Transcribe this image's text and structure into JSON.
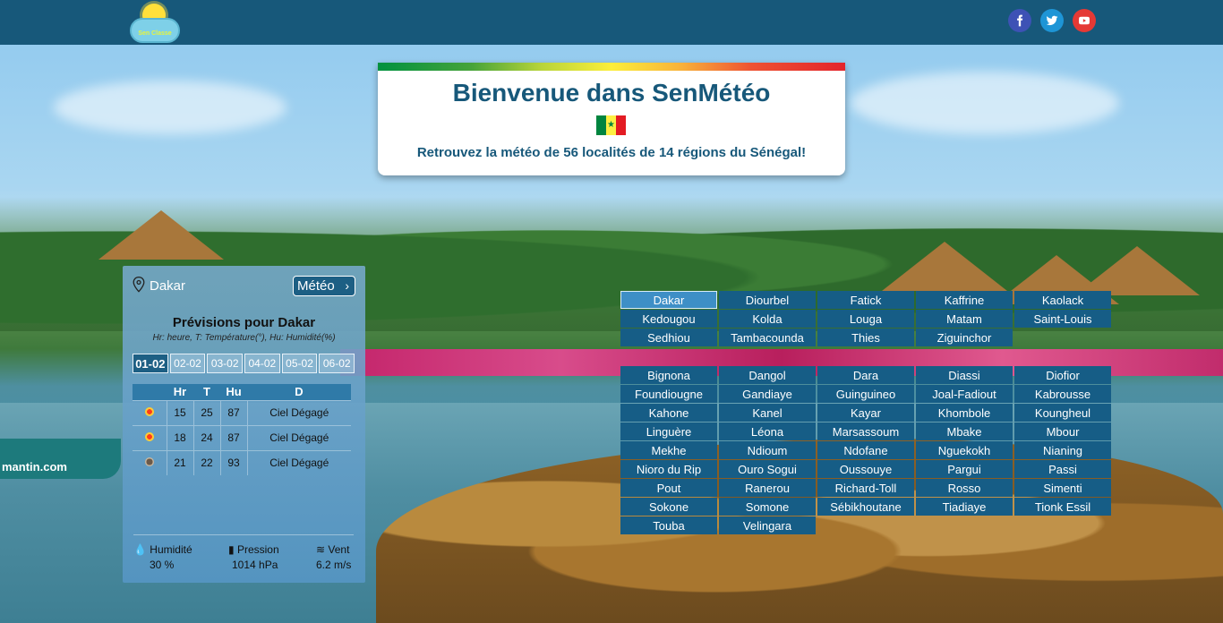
{
  "header": {
    "logo_text": "Sen Classe",
    "social": [
      {
        "name": "facebook-icon",
        "color": "#3d52b5"
      },
      {
        "name": "twitter-icon",
        "color": "#1e95d6"
      },
      {
        "name": "youtube-icon",
        "color": "#e53935"
      }
    ]
  },
  "welcome": {
    "title": "Bienvenue dans SenMétéo",
    "subtitle": "Retrouvez la météo de 56 localités de 14 régions du Sénégal!",
    "flag_colors": [
      "#00853f",
      "#fdef42",
      "#e31b23"
    ]
  },
  "scene": {
    "boat_text": "mantin.com"
  },
  "weather": {
    "city": "Dakar",
    "meteo_button": "Météo",
    "title": "Prévisions pour Dakar",
    "legend": "Hr: heure, T: Température(°), Hu: Humidité(%)",
    "days": [
      "01-02",
      "02-02",
      "03-02",
      "04-02",
      "05-02",
      "06-02"
    ],
    "active_day": "01-02",
    "columns": [
      "",
      "Hr",
      "T",
      "Hu",
      "D"
    ],
    "rows": [
      {
        "icon": "sun-icon",
        "hr": "15",
        "t": "25",
        "hu": "87",
        "d": "Ciel Dégagé"
      },
      {
        "icon": "sun-icon",
        "hr": "18",
        "t": "24",
        "hu": "87",
        "d": "Ciel Dégagé"
      },
      {
        "icon": "moon-icon",
        "hr": "21",
        "t": "22",
        "hu": "93",
        "d": "Ciel Dégagé"
      }
    ],
    "humidity_label": "Humidité",
    "humidity_value": "30 %",
    "pressure_label": "Pression",
    "pressure_value": "1014 hPa",
    "wind_label": "Vent",
    "wind_value": "6.2 m/s"
  },
  "regions": [
    "Dakar",
    "Diourbel",
    "Fatick",
    "Kaffrine",
    "Kaolack",
    "Kedougou",
    "Kolda",
    "Louga",
    "Matam",
    "Saint-Louis",
    "Sedhiou",
    "Tambacounda",
    "Thies",
    "Ziguinchor"
  ],
  "active_region": "Dakar",
  "localities": [
    "Bignona",
    "Dangol",
    "Dara",
    "Diassi",
    "Diofior",
    "Foundiougne",
    "Gandiaye",
    "Guinguineo",
    "Joal-Fadiout",
    "Kabrousse",
    "Kahone",
    "Kanel",
    "Kayar",
    "Khombole",
    "Koungheul",
    "Linguère",
    "Léona",
    "Marsassoum",
    "Mbake",
    "Mbour",
    "Mekhe",
    "Ndioum",
    "Ndofane",
    "Nguekokh",
    "Nianing",
    "Nioro du Rip",
    "Ouro Sogui",
    "Oussouye",
    "Pargui",
    "Passi",
    "Pout",
    "Ranerou",
    "Richard-Toll",
    "Rosso",
    "Simenti",
    "Sokone",
    "Somone",
    "Sébikhoutane",
    "Tiadiaye",
    "Tionk Essil",
    "Touba",
    "Velingara"
  ]
}
